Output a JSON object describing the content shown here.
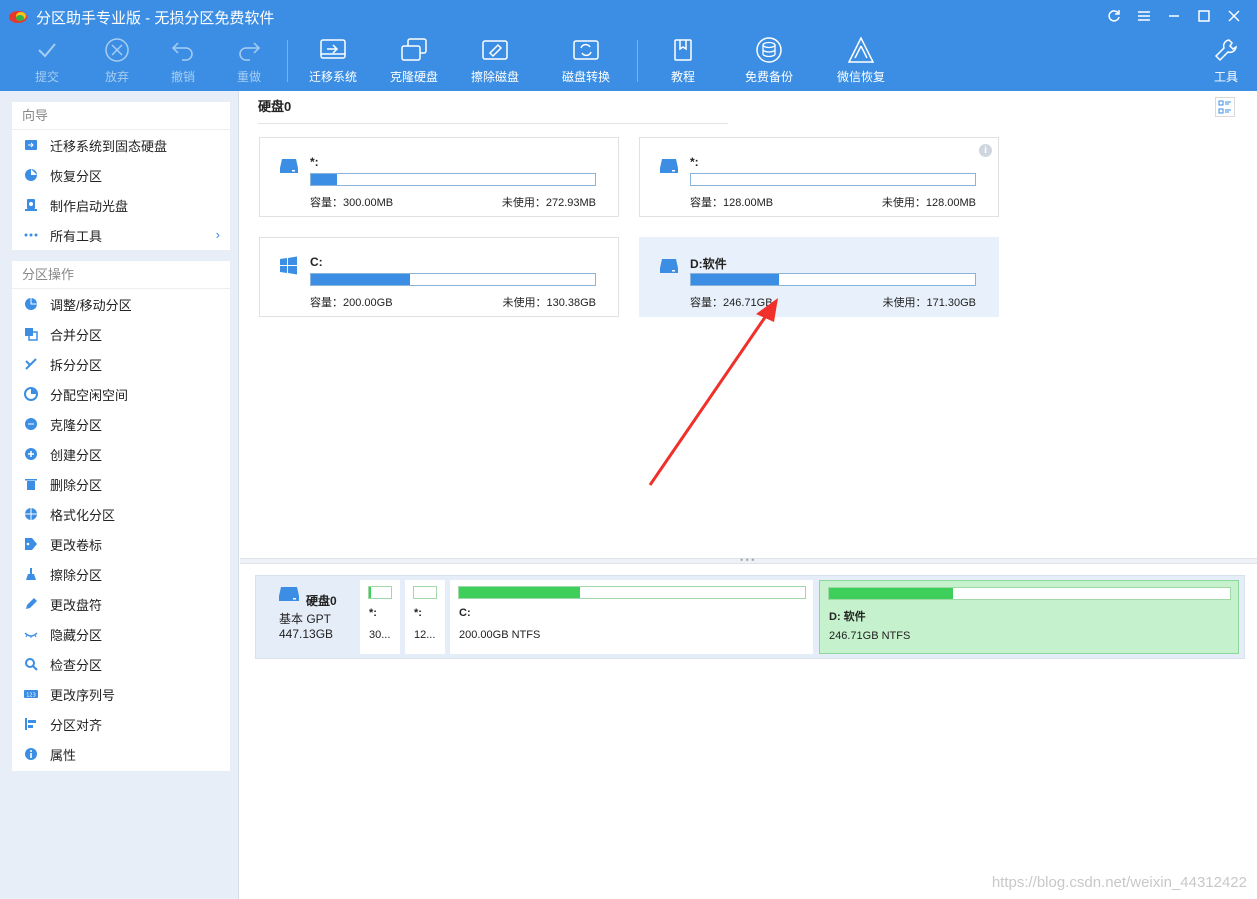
{
  "app": {
    "title": "分区助手专业版 - 无损分区免费软件",
    "accent": "#3b8ee3"
  },
  "window_controls": {
    "refresh_icon": "refresh-icon",
    "menu_icon": "menu-icon",
    "minimize_icon": "minimize-icon",
    "maximize_icon": "maximize-icon",
    "close_icon": "close-icon"
  },
  "toolbar": {
    "commit": "提交",
    "discard": "放弃",
    "undo": "撤销",
    "redo": "重做",
    "migrate": "迁移系统",
    "clone": "克隆硬盘",
    "wipe": "擦除磁盘",
    "convert": "磁盘转换",
    "tutorial": "教程",
    "backup": "免费备份",
    "wechat": "微信恢复",
    "tools": "工具"
  },
  "sidebar": {
    "wizard_title": "向导",
    "wizard_items": [
      {
        "label": "迁移系统到固态硬盘",
        "icon": "migrate-disk-icon"
      },
      {
        "label": "恢复分区",
        "icon": "recover-partition-icon"
      },
      {
        "label": "制作启动光盘",
        "icon": "bootable-disc-icon"
      },
      {
        "label": "所有工具",
        "icon": "more-dots-icon"
      }
    ],
    "ops_title": "分区操作",
    "ops_items": [
      {
        "label": "调整/移动分区",
        "icon": "resize-icon"
      },
      {
        "label": "合并分区",
        "icon": "merge-icon"
      },
      {
        "label": "拆分分区",
        "icon": "split-icon"
      },
      {
        "label": "分配空闲空间",
        "icon": "allocate-icon"
      },
      {
        "label": "克隆分区",
        "icon": "clone-icon"
      },
      {
        "label": "创建分区",
        "icon": "create-icon"
      },
      {
        "label": "删除分区",
        "icon": "delete-icon"
      },
      {
        "label": "格式化分区",
        "icon": "format-icon"
      },
      {
        "label": "更改卷标",
        "icon": "label-tag-icon"
      },
      {
        "label": "擦除分区",
        "icon": "wipe-broom-icon"
      },
      {
        "label": "更改盘符",
        "icon": "edit-pen-icon"
      },
      {
        "label": "隐藏分区",
        "icon": "hide-eye-icon"
      },
      {
        "label": "检查分区",
        "icon": "check-search-icon"
      },
      {
        "label": "更改序列号",
        "icon": "serial-number-icon"
      },
      {
        "label": "分区对齐",
        "icon": "align-icon"
      },
      {
        "label": "属性",
        "icon": "info-icon"
      }
    ]
  },
  "main": {
    "disk_title": "硬盘0",
    "cards": [
      {
        "name": "*:",
        "used_fraction": 0.09,
        "capacity": "容量：300.00MB",
        "free": "未使用：272.93MB"
      },
      {
        "name": "*:",
        "used_fraction": 0.0,
        "capacity": "容量：128.00MB",
        "free": "未使用：128.00MB"
      },
      {
        "name": "C:",
        "used_fraction": 0.35,
        "capacity": "容量：200.00GB",
        "free": "未使用：130.38GB"
      },
      {
        "name": "D:软件",
        "used_fraction": 0.31,
        "capacity": "容量：246.71GB",
        "free": "未使用：171.30GB"
      }
    ]
  },
  "diskmap": {
    "name": "硬盘0",
    "type": "基本 GPT",
    "size": "447.13GB",
    "partitions": [
      {
        "label": "*:",
        "sub": "30...",
        "used_fraction": 0.1
      },
      {
        "label": "*:",
        "sub": "12...",
        "used_fraction": 0.0
      },
      {
        "label": "C:",
        "sub": "200.00GB NTFS",
        "used_fraction": 0.35
      },
      {
        "label": "D: 软件",
        "sub": "246.71GB NTFS",
        "used_fraction": 0.31
      }
    ]
  },
  "watermark": "https://blog.csdn.net/weixin_44312422"
}
